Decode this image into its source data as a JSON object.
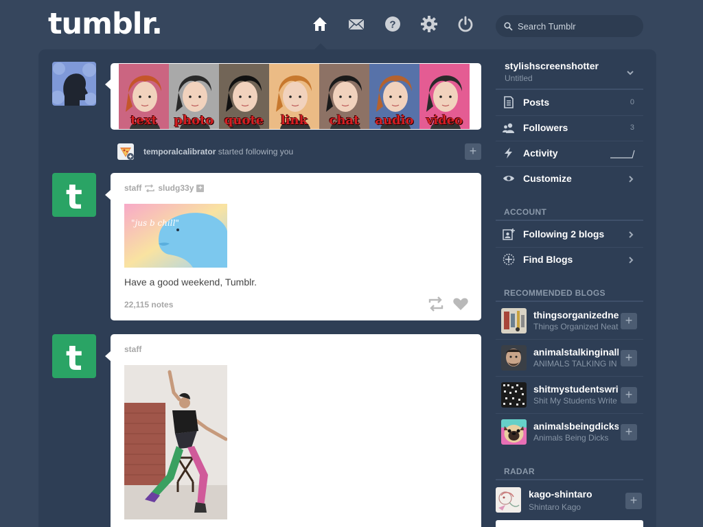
{
  "header": {
    "logo": "tumblr.",
    "nav": [
      {
        "name": "home-icon"
      },
      {
        "name": "messages-icon"
      },
      {
        "name": "help-icon"
      },
      {
        "name": "settings-icon"
      },
      {
        "name": "logout-icon"
      }
    ],
    "search_placeholder": "Search Tumblr"
  },
  "post_types": [
    {
      "label": "text",
      "color": "#c24a6b"
    },
    {
      "label": "photo",
      "color": "#9a9a9a"
    },
    {
      "label": "quote",
      "color": "#5a4a3a"
    },
    {
      "label": "link",
      "color": "#e8b070"
    },
    {
      "label": "chat",
      "color": "#7a5a4a"
    },
    {
      "label": "audio",
      "color": "#3a5a9a"
    },
    {
      "label": "video",
      "color": "#e04080"
    }
  ],
  "notification": {
    "user": "temporalcalibrator",
    "action": "started following you"
  },
  "posts": [
    {
      "author": "staff",
      "reblogged_from": "sludg33y",
      "image_text": "\"jus b chill\"",
      "caption": "Have a good weekend, Tumblr.",
      "notes": "22,115 notes"
    },
    {
      "author": "staff"
    }
  ],
  "sidebar": {
    "blog_name": "stylishscreenshotter",
    "blog_subtitle": "Untitled",
    "menu": [
      {
        "label": "Posts",
        "count": "0",
        "icon": "posts-icon"
      },
      {
        "label": "Followers",
        "count": "3",
        "icon": "followers-icon"
      },
      {
        "label": "Activity",
        "count": "",
        "icon": "activity-icon"
      },
      {
        "label": "Customize",
        "count": "",
        "icon": "eye-icon"
      }
    ],
    "account_title": "ACCOUNT",
    "account": [
      {
        "label": "Following 2 blogs",
        "icon": "following-icon"
      },
      {
        "label": "Find Blogs",
        "icon": "find-blogs-icon"
      }
    ],
    "recommended_title": "RECOMMENDED BLOGS",
    "recommended": [
      {
        "name": "thingsorganizedneatly",
        "subtitle": "Things Organized Neatly"
      },
      {
        "name": "animalstalkinginallcaps",
        "subtitle": "ANIMALS TALKING IN ALL CAPS"
      },
      {
        "name": "shitmystudentswrite",
        "subtitle": "Shit My Students Write"
      },
      {
        "name": "animalsbeingdicks",
        "subtitle": "Animals Being Dicks"
      }
    ],
    "radar_title": "RADAR",
    "radar": {
      "name": "kago-shintaro",
      "subtitle": "Shintaro Kago"
    }
  }
}
